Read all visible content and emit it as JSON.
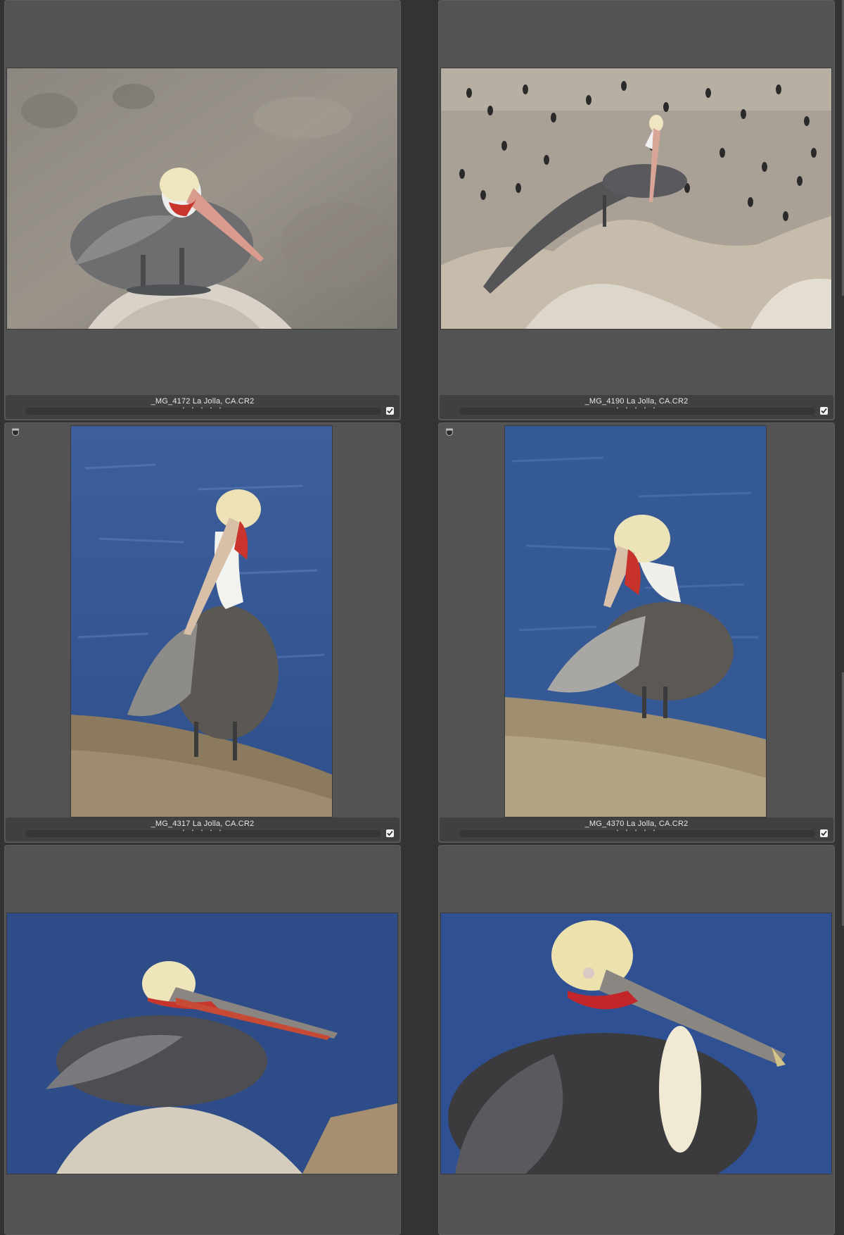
{
  "grid": {
    "thumbnails": [
      {
        "filename": "_MG_4172  La  Jolla, CA.CR2",
        "checked": true,
        "rating_dots": "• • • • •",
        "has_badge": false
      },
      {
        "filename": "_MG_4190  La  Jolla, CA.CR2",
        "checked": true,
        "rating_dots": "• • • • •",
        "has_badge": false
      },
      {
        "filename": "_MG_4317  La  Jolla, CA.CR2",
        "checked": true,
        "rating_dots": "• • • • •",
        "has_badge": true
      },
      {
        "filename": "_MG_4370  La  Jolla, CA.CR2",
        "checked": true,
        "rating_dots": "• • • • •",
        "has_badge": true
      },
      {
        "filename": "",
        "checked": false,
        "rating_dots": "",
        "has_badge": false
      },
      {
        "filename": "",
        "checked": false,
        "rating_dots": "",
        "has_badge": false
      }
    ]
  },
  "colors": {
    "background": "#333333",
    "cell": "#535353",
    "infobar": "#404040",
    "text": "#e8e8e8"
  }
}
